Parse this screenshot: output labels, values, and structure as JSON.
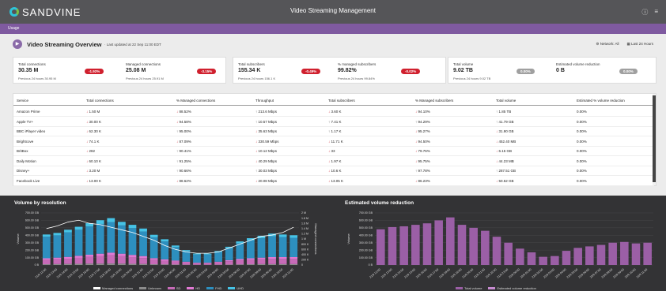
{
  "app": {
    "brand": "SANDVINE",
    "title": "Video Streaming Management",
    "help_icon": "help-icon",
    "menu_icon": "menu-icon"
  },
  "tabs": [
    {
      "label": "Usage"
    }
  ],
  "overview": {
    "title": "Video Streaming Overview",
    "updated": "· Last updated at 22 Sep 11:00 EDT",
    "network": "Network: All",
    "range": "Last 24 Hours"
  },
  "kpis": [
    {
      "label": "Total connections",
      "value": "30.35 M",
      "badge": "-1.92%",
      "prev": "Previous 24 hours 30.95 M",
      "badge_color": "red"
    },
    {
      "label": "Managed connections",
      "value": "25.08 M",
      "badge": "-3.15%",
      "prev": "Previous 24 hours 25.91 M",
      "badge_color": "red"
    },
    {
      "label": "Total subscribers",
      "value": "155.34 K",
      "badge": "-0.49%",
      "prev": "Previous 24 hours 156.1 K",
      "badge_color": "red"
    },
    {
      "label": "% managed subscribers",
      "value": "99.82%",
      "badge": "-0.02%",
      "prev": "Previous 24 hours 99.84%",
      "badge_color": "red"
    },
    {
      "label": "Total volume",
      "value": "9.02 TB",
      "badge": "0.00%",
      "prev": "Previous 24 hours 9.02 TB",
      "badge_color": "grey"
    },
    {
      "label": "Estimated volume reduction",
      "value": "0 B",
      "badge": "0.00%",
      "prev": "",
      "badge_color": "grey"
    }
  ],
  "table": {
    "headers": [
      "Service",
      "Total connections",
      "% Managed connections",
      "Throughput",
      "Total subscribers",
      "% Managed subscribers",
      "Total volume",
      "Estimated % volume reduction"
    ],
    "rows": [
      [
        [
          "Amazon Prime",
          ""
        ],
        [
          "1.50 M",
          "down"
        ],
        [
          "88.52%",
          "down"
        ],
        [
          "213.6 Mbps",
          "up"
        ],
        [
          "3.60 K",
          "down"
        ],
        [
          "94.10%",
          "down"
        ],
        [
          "1.85 TB",
          "up"
        ],
        [
          "0.00%",
          ""
        ]
      ],
      [
        [
          "Apple TV+",
          ""
        ],
        [
          "30.00 K",
          "down"
        ],
        [
          "94.58%",
          "down"
        ],
        [
          "10.57 Mbps",
          "up"
        ],
        [
          "7.41 K",
          "up"
        ],
        [
          "94.29%",
          "up"
        ],
        [
          "41.79 GB",
          "up"
        ],
        [
          "0.00%",
          ""
        ]
      ],
      [
        [
          "BBC iPlayer video",
          ""
        ],
        [
          "62.30 K",
          "down"
        ],
        [
          "95.00%",
          "up"
        ],
        [
          "35.63 Mbps",
          "down"
        ],
        [
          "1.17 K",
          "up"
        ],
        [
          "95.27%",
          "down"
        ],
        [
          "31.90 GB",
          "down"
        ],
        [
          "0.00%",
          ""
        ]
      ],
      [
        [
          "Brightcove",
          ""
        ],
        [
          "74.1 K",
          "down"
        ],
        [
          "87.09%",
          "down"
        ],
        [
          "330.59 Mbps",
          "down"
        ],
        [
          "11.71 K",
          "down"
        ],
        [
          "94.50%",
          "down"
        ],
        [
          "452.40 MB",
          "down"
        ],
        [
          "0.00%",
          ""
        ]
      ],
      [
        [
          "BritBox",
          ""
        ],
        [
          "282",
          "down"
        ],
        [
          "90.41%",
          "up"
        ],
        [
          "10.12 Mbps",
          "down"
        ],
        [
          "33",
          "down"
        ],
        [
          "79.76%",
          "down"
        ],
        [
          "6.15 GB",
          "down"
        ],
        [
          "0.00%",
          ""
        ]
      ],
      [
        [
          "Daily Motion",
          ""
        ],
        [
          "60.10 K",
          "down"
        ],
        [
          "91.25%",
          "up"
        ],
        [
          "40.29 Mbps",
          "down"
        ],
        [
          "1.97 K",
          "down"
        ],
        [
          "95.75%",
          "down"
        ],
        [
          "44.23 MB",
          "down"
        ],
        [
          "0.00%",
          ""
        ]
      ],
      [
        [
          "Disney+",
          ""
        ],
        [
          "3.20 M",
          "down"
        ],
        [
          "90.66%",
          "up"
        ],
        [
          "30.03 Mbps",
          "up"
        ],
        [
          "10.6 K",
          "down"
        ],
        [
          "97.78%",
          "up"
        ],
        [
          "287.51 GB",
          "up"
        ],
        [
          "0.00%",
          ""
        ]
      ],
      [
        [
          "Facebook Live",
          ""
        ],
        [
          "13.00 K",
          "down"
        ],
        [
          "88.62%",
          "down"
        ],
        [
          "20.08 Mbps",
          "down"
        ],
        [
          "13.05 K",
          "down"
        ],
        [
          "86.23%",
          "down"
        ],
        [
          "50.52 GB",
          "down"
        ],
        [
          "0.00%",
          ""
        ]
      ]
    ]
  },
  "chart_data": [
    {
      "type": "bar",
      "title": "Volume by resolution",
      "ylabel": "Volume",
      "y2label": "Managed connections",
      "ylim": [
        0,
        700
      ],
      "y_unit": "GB",
      "y_ticks": [
        "700.00 GB",
        "600.00 GB",
        "500.00 GB",
        "400.00 GB",
        "300.00 GB",
        "200.00 GB",
        "100.00 GB",
        "0 B"
      ],
      "y2_ticks": [
        "2 M",
        "1.8 M",
        "1.6 M",
        "1.4 M",
        "1.2 M",
        "1 M",
        "800 K",
        "600 K",
        "400 K",
        "200 K",
        "0"
      ],
      "y2lim": [
        0,
        2000
      ],
      "categories": [
        "21/9 12:00",
        "21/9 13:00",
        "21/9 14:00",
        "21/9 15:00",
        "21/9 16:00",
        "21/9 17:00",
        "21/9 18:00",
        "21/9 19:00",
        "21/9 20:00",
        "21/9 21:00",
        "21/9 22:00",
        "21/9 23:00",
        "22/9 00:00",
        "22/9 01:00",
        "22/9 02:00",
        "22/9 03:00",
        "22/9 04:00",
        "22/9 05:00",
        "22/9 06:00",
        "22/9 07:00",
        "22/9 08:00",
        "22/9 09:00",
        "22/9 10:00",
        "22/9 11:00"
      ],
      "series": [
        {
          "name": "Unknown",
          "color": "#8c8c8c",
          "values": [
            10,
            12,
            14,
            16,
            18,
            18,
            20,
            18,
            16,
            14,
            10,
            8,
            6,
            4,
            3,
            3,
            4,
            6,
            8,
            10,
            12,
            12,
            12,
            12
          ]
        },
        {
          "name": "SD",
          "color": "#c76bb8",
          "values": [
            60,
            65,
            70,
            80,
            90,
            100,
            110,
            100,
            90,
            80,
            60,
            50,
            40,
            30,
            20,
            20,
            30,
            45,
            55,
            60,
            65,
            70,
            70,
            70
          ]
        },
        {
          "name": "HD",
          "color": "#e27ad4",
          "values": [
            20,
            22,
            25,
            28,
            30,
            34,
            36,
            34,
            30,
            26,
            22,
            18,
            14,
            10,
            8,
            8,
            10,
            14,
            18,
            20,
            22,
            24,
            24,
            24
          ]
        },
        {
          "name": "FHD",
          "color": "#2d8fbf",
          "values": [
            290,
            300,
            330,
            350,
            380,
            400,
            410,
            380,
            360,
            330,
            280,
            240,
            180,
            140,
            110,
            110,
            130,
            160,
            210,
            240,
            260,
            280,
            270,
            260
          ]
        },
        {
          "name": "UHD",
          "color": "#46c3e6",
          "values": [
            30,
            32,
            35,
            40,
            44,
            50,
            54,
            48,
            44,
            40,
            34,
            30,
            22,
            16,
            12,
            12,
            14,
            20,
            26,
            30,
            34,
            36,
            34,
            34
          ]
        }
      ],
      "line": {
        "name": "Managed connections",
        "color": "#ffffff",
        "values": [
          1400,
          1500,
          1650,
          1720,
          1600,
          1550,
          1450,
          1350,
          1250,
          1100,
          950,
          750,
          600,
          500,
          450,
          450,
          500,
          650,
          800,
          950,
          1100,
          1150,
          1250,
          1450
        ]
      }
    },
    {
      "type": "bar",
      "title": "Estimated volume reduction",
      "ylabel": "Volume",
      "ylim": [
        0,
        700
      ],
      "y_ticks": [
        "700.00 GB",
        "600.00 GB",
        "500.00 GB",
        "400.00 GB",
        "300.00 GB",
        "200.00 GB",
        "100.00 GB",
        "0 B"
      ],
      "categories": [
        "21/9 12:00",
        "21/9 13:00",
        "21/9 14:00",
        "21/9 15:00",
        "21/9 16:00",
        "21/9 17:00",
        "21/9 18:00",
        "21/9 19:00",
        "21/9 20:00",
        "21/9 21:00",
        "21/9 22:00",
        "21/9 23:00",
        "22/9 00:00",
        "22/9 01:00",
        "22/9 02:00",
        "22/9 03:00",
        "22/9 04:00",
        "22/9 05:00",
        "22/9 06:00",
        "22/9 07:00",
        "22/9 08:00",
        "22/9 09:00",
        "22/9 10:00",
        "22/9 11:00"
      ],
      "series": [
        {
          "name": "Total volume",
          "color": "#9b5fa6",
          "values": [
            480,
            510,
            520,
            540,
            560,
            600,
            640,
            540,
            500,
            460,
            380,
            300,
            220,
            170,
            110,
            120,
            190,
            230,
            250,
            270,
            300,
            310,
            290,
            300
          ]
        },
        {
          "name": "Estimated volume reduction",
          "color": "#c78bd0",
          "values": [
            0,
            0,
            0,
            0,
            0,
            0,
            0,
            0,
            0,
            0,
            0,
            0,
            0,
            0,
            0,
            0,
            0,
            0,
            0,
            0,
            0,
            0,
            0,
            0
          ]
        }
      ]
    }
  ]
}
